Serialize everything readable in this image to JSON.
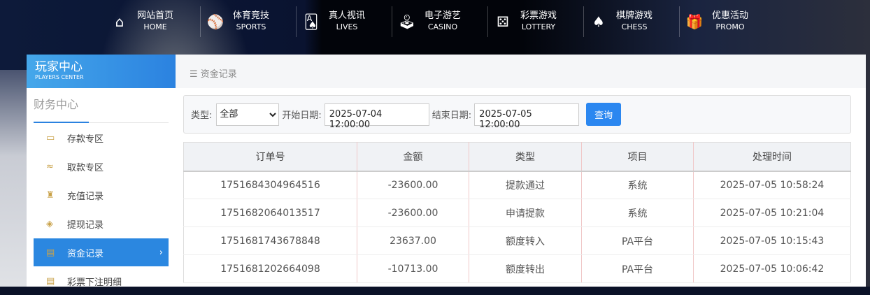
{
  "nav": [
    {
      "cn": "网站首页",
      "en": "HOME",
      "icon": "home-icon",
      "glyph": "⌂"
    },
    {
      "cn": "体育竞技",
      "en": "SPORTS",
      "icon": "ball-icon",
      "glyph": "⚾"
    },
    {
      "cn": "真人视讯",
      "en": "LIVES",
      "icon": "cards-icon",
      "glyph": "🂡"
    },
    {
      "cn": "电子游艺",
      "en": "CASINO",
      "icon": "joystick-icon",
      "glyph": "🕹"
    },
    {
      "cn": "彩票游戏",
      "en": "LOTTERY",
      "icon": "dice-icon",
      "glyph": "⚄"
    },
    {
      "cn": "棋牌游戏",
      "en": "CHESS",
      "icon": "spade-icon",
      "glyph": "♠"
    },
    {
      "cn": "优惠活动",
      "en": "PROMO",
      "icon": "gift-icon",
      "glyph": "🎁"
    }
  ],
  "sidebar": {
    "title": "玩家中心",
    "subtitle": "PLAYERS CENTER",
    "section": "财务中心",
    "items": [
      {
        "label": "存款专区",
        "icon": "card-icon",
        "glyph": "▭"
      },
      {
        "label": "取款专区",
        "icon": "hand-money-icon",
        "glyph": "≈"
      },
      {
        "label": "充值记录",
        "icon": "money-bag-icon",
        "glyph": "♜"
      },
      {
        "label": "提现记录",
        "icon": "wallet-icon",
        "glyph": "◈"
      },
      {
        "label": "资金记录",
        "icon": "funds-icon",
        "glyph": "▤",
        "active": true
      },
      {
        "label": "彩票下注明细",
        "icon": "list-icon",
        "glyph": "▤"
      }
    ]
  },
  "breadcrumb": "资金记录",
  "filter": {
    "type_label": "类型:",
    "type_value": "全部",
    "start_label": "开始日期:",
    "start_value": "2025-07-04 12:00:00",
    "end_label": "结束日期:",
    "end_value": "2025-07-05 12:00:00",
    "search": "查询"
  },
  "table": {
    "headers": [
      "订单号",
      "金额",
      "类型",
      "项目",
      "处理时间"
    ],
    "rows": [
      [
        "1751684304964516",
        "-23600.00",
        "提款通过",
        "系统",
        "2025-07-05 10:58:24"
      ],
      [
        "1751682064013517",
        "-23600.00",
        "申请提款",
        "系统",
        "2025-07-05 10:21:04"
      ],
      [
        "1751681743678848",
        "23637.00",
        "额度转入",
        "PA平台",
        "2025-07-05 10:15:43"
      ],
      [
        "1751681202664098",
        "-10713.00",
        "额度转出",
        "PA平台",
        "2025-07-05 10:06:42"
      ]
    ]
  }
}
